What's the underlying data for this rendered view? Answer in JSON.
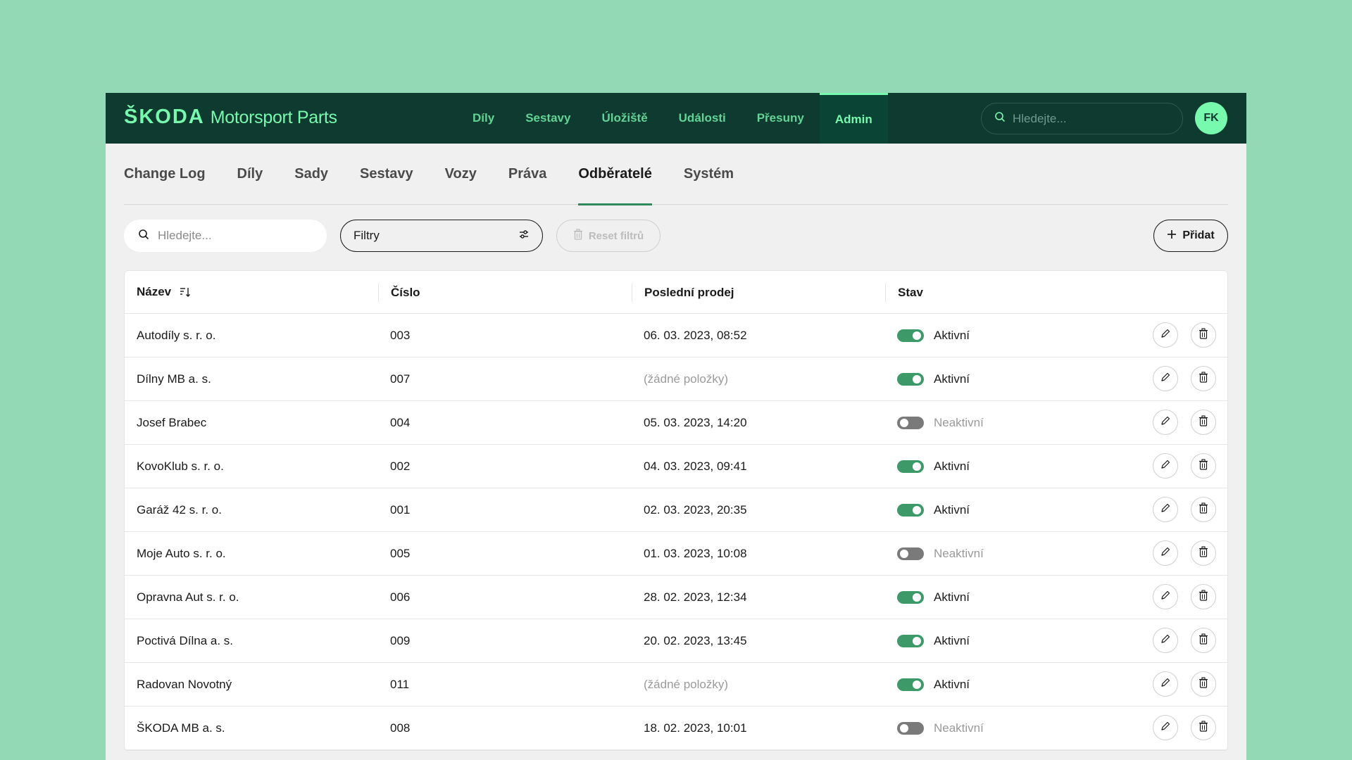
{
  "header": {
    "brand": "ŠKODA",
    "subtitle": "Motorsport Parts",
    "nav": [
      {
        "label": "Díly",
        "active": false
      },
      {
        "label": "Sestavy",
        "active": false
      },
      {
        "label": "Úložiště",
        "active": false
      },
      {
        "label": "Události",
        "active": false
      },
      {
        "label": "Přesuny",
        "active": false
      },
      {
        "label": "Admin",
        "active": true
      }
    ],
    "search_placeholder": "Hledejte...",
    "avatar_initials": "FK"
  },
  "tabs": [
    {
      "label": "Change Log",
      "active": false
    },
    {
      "label": "Díly",
      "active": false
    },
    {
      "label": "Sady",
      "active": false
    },
    {
      "label": "Sestavy",
      "active": false
    },
    {
      "label": "Vozy",
      "active": false
    },
    {
      "label": "Práva",
      "active": false
    },
    {
      "label": "Odběratelé",
      "active": true
    },
    {
      "label": "Systém",
      "active": false
    }
  ],
  "toolbar": {
    "search_placeholder": "Hledejte...",
    "filter_label": "Filtry",
    "reset_label": "Reset filtrů",
    "add_label": "Přidat"
  },
  "table": {
    "columns": [
      "Název",
      "Číslo",
      "Poslední prodej",
      "Stav"
    ],
    "rows": [
      {
        "name": "Autodíly s. r. o.",
        "number": "003",
        "last_sale": "06. 03. 2023, 08:52",
        "has_sale": true,
        "active": true,
        "status": "Aktivní"
      },
      {
        "name": "Dílny MB a. s.",
        "number": "007",
        "last_sale": "(žádné položky)",
        "has_sale": false,
        "active": true,
        "status": "Aktivní"
      },
      {
        "name": "Josef Brabec",
        "number": "004",
        "last_sale": "05. 03. 2023, 14:20",
        "has_sale": true,
        "active": false,
        "status": "Neaktivní"
      },
      {
        "name": "KovoKlub s. r. o.",
        "number": "002",
        "last_sale": "04. 03. 2023, 09:41",
        "has_sale": true,
        "active": true,
        "status": "Aktivní"
      },
      {
        "name": "Garáž 42 s. r. o.",
        "number": "001",
        "last_sale": "02. 03. 2023, 20:35",
        "has_sale": true,
        "active": true,
        "status": "Aktivní"
      },
      {
        "name": "Moje Auto s. r. o.",
        "number": "005",
        "last_sale": "01. 03. 2023, 10:08",
        "has_sale": true,
        "active": false,
        "status": "Neaktivní"
      },
      {
        "name": "Opravna Aut s. r. o.",
        "number": "006",
        "last_sale": "28. 02. 2023, 12:34",
        "has_sale": true,
        "active": true,
        "status": "Aktivní"
      },
      {
        "name": "Poctivá Dílna a. s.",
        "number": "009",
        "last_sale": "20. 02. 2023, 13:45",
        "has_sale": true,
        "active": true,
        "status": "Aktivní"
      },
      {
        "name": "Radovan Novotný",
        "number": "011",
        "last_sale": "(žádné položky)",
        "has_sale": false,
        "active": true,
        "status": "Aktivní"
      },
      {
        "name": "ŠKODA MB a. s.",
        "number": "008",
        "last_sale": "18. 02. 2023, 10:01",
        "has_sale": true,
        "active": false,
        "status": "Neaktivní"
      }
    ]
  },
  "colors": {
    "background": "#93d9b5",
    "topbar": "#0e3a2f",
    "accent": "#78faae",
    "toggle_on": "#3d9a68",
    "toggle_off": "#7a7a7a"
  }
}
